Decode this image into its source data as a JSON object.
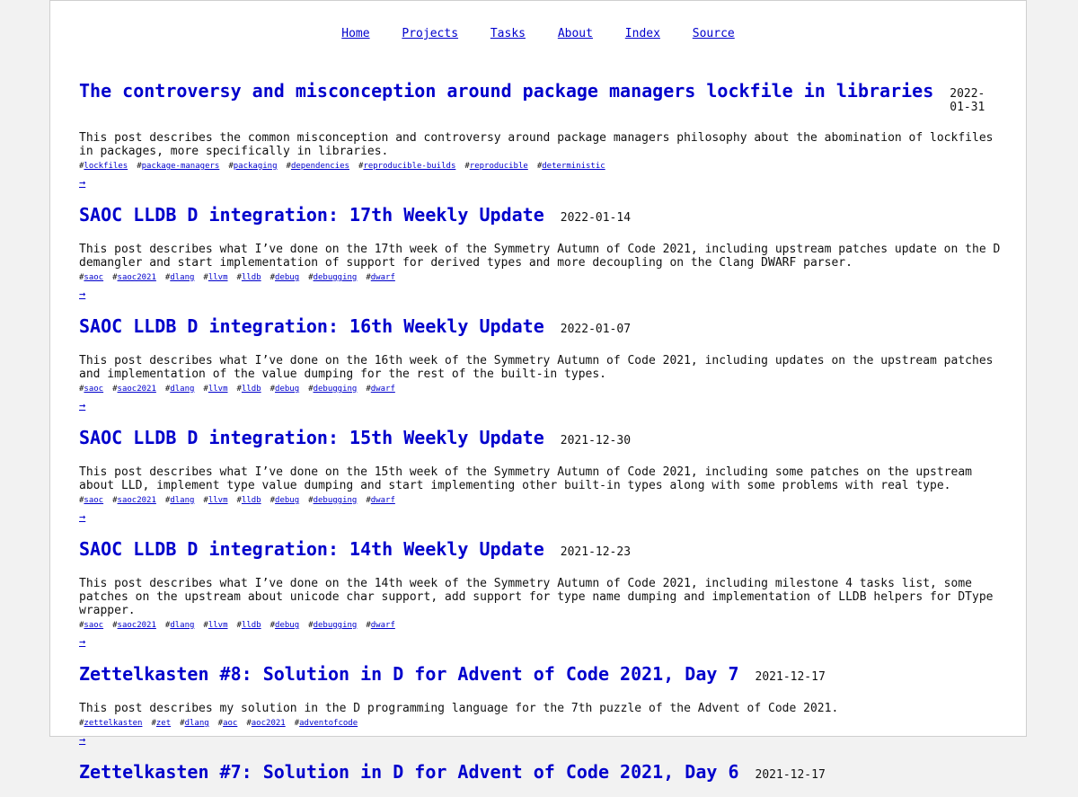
{
  "nav": [
    "Home",
    "Projects",
    "Tasks",
    "About",
    "Index",
    "Source"
  ],
  "more_symbol": "→",
  "tag_prefix": "#",
  "posts": [
    {
      "title": "The controversy and misconception around package managers lockfile in libraries",
      "date": "2022-01-31",
      "description": "This post describes the common misconception and controversy around package managers philosophy about the abomination of lockfiles in packages, more specifically in libraries.",
      "tags": [
        "lockfiles",
        "package-managers",
        "packaging",
        "dependencies",
        "reproducible-builds",
        "reproducible",
        "deterministic"
      ]
    },
    {
      "title": "SAOC LLDB D integration: 17th Weekly Update",
      "date": "2022-01-14",
      "description": "This post describes what I’ve done on the 17th week of the Symmetry Autumn of Code 2021, including upstream patches update on the D demangler and start implementation of support for derived types and more decoupling on the Clang DWARF parser.",
      "tags": [
        "saoc",
        "saoc2021",
        "dlang",
        "llvm",
        "lldb",
        "debug",
        "debugging",
        "dwarf"
      ]
    },
    {
      "title": "SAOC LLDB D integration: 16th Weekly Update",
      "date": "2022-01-07",
      "description": "This post describes what I’ve done on the 16th week of the Symmetry Autumn of Code 2021, including updates on the upstream patches and implementation of the value dumping for the rest of the built-in types.",
      "tags": [
        "saoc",
        "saoc2021",
        "dlang",
        "llvm",
        "lldb",
        "debug",
        "debugging",
        "dwarf"
      ]
    },
    {
      "title": "SAOC LLDB D integration: 15th Weekly Update",
      "date": "2021-12-30",
      "description": "This post describes what I’ve done on the 15th week of the Symmetry Autumn of Code 2021, including some patches on the upstream about LLD, implement type value dumping and start implementing other built-in types along with some problems with real type.",
      "tags": [
        "saoc",
        "saoc2021",
        "dlang",
        "llvm",
        "lldb",
        "debug",
        "debugging",
        "dwarf"
      ]
    },
    {
      "title": "SAOC LLDB D integration: 14th Weekly Update",
      "date": "2021-12-23",
      "description": "This post describes what I’ve done on the 14th week of the Symmetry Autumn of Code 2021, including milestone 4 tasks list, some patches on the upstream about unicode char support, add support for type name dumping and implementation of LLDB helpers for DType wrapper.",
      "tags": [
        "saoc",
        "saoc2021",
        "dlang",
        "llvm",
        "lldb",
        "debug",
        "debugging",
        "dwarf"
      ]
    },
    {
      "title": "Zettelkasten #8: Solution in D for Advent of Code 2021, Day 7",
      "date": "2021-12-17",
      "description": "This post describes my solution in the D programming language for the 7th puzzle of the Advent of Code 2021.",
      "tags": [
        "zettelkasten",
        "zet",
        "dlang",
        "aoc",
        "aoc2021",
        "adventofcode"
      ]
    },
    {
      "title": "Zettelkasten #7: Solution in D for Advent of Code 2021, Day 6",
      "date": "2021-12-17",
      "description": "",
      "tags": []
    }
  ]
}
